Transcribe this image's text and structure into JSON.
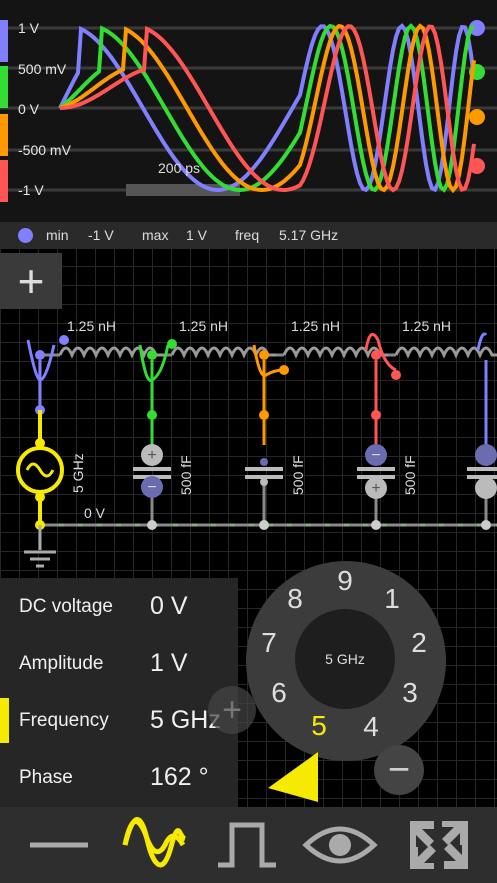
{
  "oscilloscope": {
    "y_labels": [
      "1 V",
      "500 mV",
      "0 V",
      "-500 mV",
      "-1 V"
    ],
    "timebase_label": "200 ps",
    "channel_colors": [
      "#8080ff",
      "#33dd33",
      "#ff9900",
      "#ff5555"
    ],
    "trace_icon": "waveform-trace"
  },
  "stats": {
    "min_label": "min",
    "min_value": "-1 V",
    "max_label": "max",
    "max_value": "1 V",
    "freq_label": "freq",
    "freq_value": "5.17 GHz"
  },
  "circuit": {
    "add_button": "+",
    "inductor_labels": [
      "1.25 nH",
      "1.25 nH",
      "1.25 nH",
      "1.25 nH"
    ],
    "source_label": "5 GHz",
    "capacitor_labels": [
      "500 fF",
      "500 fF",
      "500 fF"
    ],
    "ground_label": "0 V"
  },
  "properties": [
    {
      "label": "DC voltage",
      "value": "0 V"
    },
    {
      "label": "Amplitude",
      "value": "1 V"
    },
    {
      "label": "Frequency",
      "value": "5 GHz",
      "selected": true
    },
    {
      "label": "Phase",
      "value": "162 °"
    }
  ],
  "dial": {
    "center_value": "5 GHz",
    "numbers": [
      "9",
      "1",
      "2",
      "3",
      "4",
      "5",
      "6",
      "7",
      "8"
    ],
    "selected_number": "5",
    "plus_label": "+",
    "minus_label": "−"
  },
  "toolbar": [
    "wire-tool",
    "sine-source-tool",
    "pulse-source-tool",
    "probe-view-tool",
    "shuffle-tool"
  ]
}
